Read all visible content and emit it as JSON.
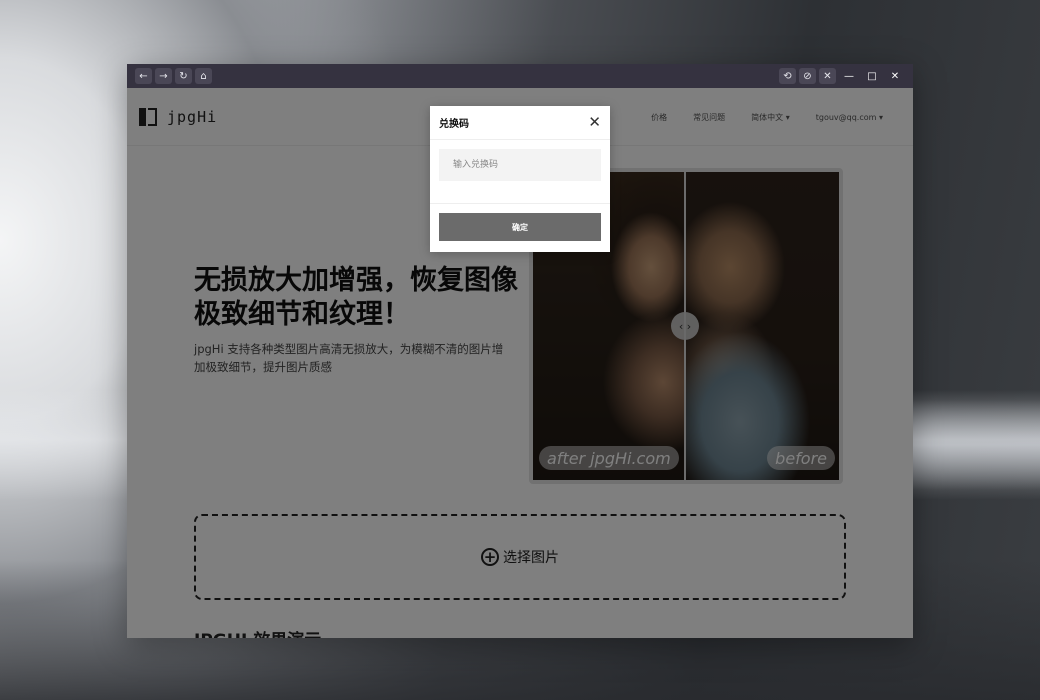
{
  "browser": {
    "nav": {
      "back": "←",
      "forward": "→",
      "reload": "↻",
      "home": "⌂"
    },
    "tools": {
      "tool1": "⟲",
      "tool2": "⊘",
      "tool3": "✕"
    },
    "window": {
      "minimize": "—",
      "maximize": "□",
      "close": "✕"
    }
  },
  "site": {
    "logo_text": "jpgHi",
    "nav": [
      "价格",
      "常见问题",
      "简体中文 ▾",
      "tgouv@qq.com ▾"
    ]
  },
  "hero": {
    "title": "无损放大加增强，恢复图像极致细节和纹理！",
    "subtitle": "jpgHi 支持各种类型图片高清无损放大，为模糊不清的图片增加极致细节，提升图片质感"
  },
  "compare": {
    "after_label": "after jpgHi.com",
    "before_label": "before",
    "handle": "‹ ›"
  },
  "upload": {
    "label": "选择图片"
  },
  "section": {
    "peek_title": "JPGHI 效果演示"
  },
  "modal": {
    "title": "兑换码",
    "input_placeholder": "输入兑换码",
    "confirm_label": "确定"
  }
}
